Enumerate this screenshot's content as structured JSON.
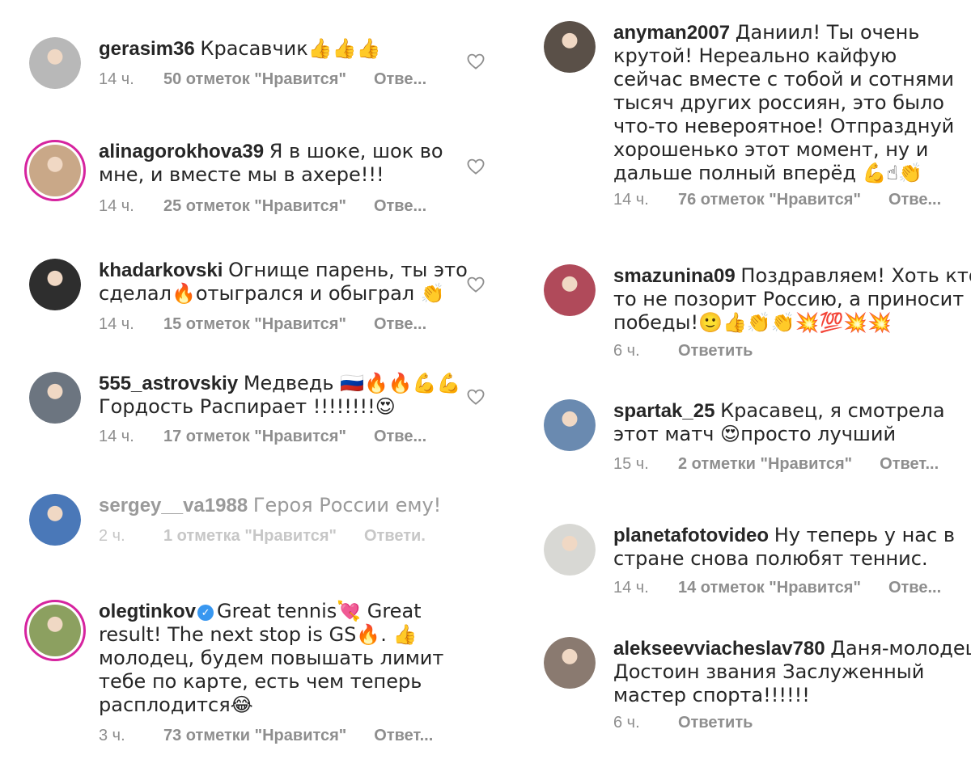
{
  "left_comments": [
    {
      "username": "gerasim36",
      "lines": [
        "Красавчик👍👍👍"
      ],
      "time": "14 ч.",
      "likes": "50 отметок \"Нравится\"",
      "reply": "Отве...",
      "avatar_color": "#b8b8b8"
    },
    {
      "username": "alinagorokhova39",
      "lines": [
        "Я в шоке, шок во",
        "мне, и вместе мы в ахере!!!"
      ],
      "time": "14 ч.",
      "likes": "25 отметок \"Нравится\"",
      "reply": "Отве...",
      "avatar_color": "#c9a888"
    },
    {
      "username": "khadarkovski",
      "lines": [
        "Огнище парень, ты это",
        "сделал🔥отыгрался и обыграл 👏"
      ],
      "time": "14 ч.",
      "likes": "15 отметок \"Нравится\"",
      "reply": "Отве...",
      "avatar_color": "#2e2e2e"
    },
    {
      "username": "555_astrovskiy",
      "lines": [
        "Медведь 🇷🇺🔥🔥💪💪",
        "Гордость Распирает !!!!!!!!😍"
      ],
      "time": "14 ч.",
      "likes": "17 отметок \"Нравится\"",
      "reply": "Отве...",
      "avatar_color": "#6c7580"
    },
    {
      "username": "sergey__va1988",
      "lines": [
        "Героя России ему!"
      ],
      "time": "2 ч.",
      "likes": "1 отметка \"Нравится\"",
      "reply": "Ответи.",
      "avatar_color": "#4a78b8"
    },
    {
      "username": "olegtinkov",
      "verified": true,
      "lines": [
        "Great tennis💘 Great",
        "result! The next stop is GS🔥. 👍",
        "молодец, будем повышать лимит",
        "тебе по карте, есть чем теперь",
        "расплодится😂"
      ],
      "time": "3 ч.",
      "likes": "73 отметки \"Нравится\"",
      "reply": "Ответ...",
      "avatar_color": "#8ca060"
    }
  ],
  "right_comments": [
    {
      "username": "anyman2007",
      "lines": [
        "Даниил! Ты очень",
        "крутой! Нереально кайфую",
        "сейчас вместе с тобой и сотнями",
        "тысяч других россиян, это было",
        "что-то невероятное! Отпразднуй",
        "хорошенько этот момент, ну и",
        "дальше полный вперёд 💪☝👏"
      ],
      "time": "14 ч.",
      "likes": "76 отметок \"Нравится\"",
      "reply": "Отве...",
      "avatar_color": "#5a5048"
    },
    {
      "username": "smazunina09",
      "lines": [
        "Поздравляем! Хоть кто",
        "то не позорит Россию,  а приносит",
        "победы!🙂👍👏👏💥💯💥💥"
      ],
      "time": "6 ч.",
      "likes": "",
      "reply": "Ответить",
      "avatar_color": "#b04a5a"
    },
    {
      "username": "spartak_25",
      "lines": [
        "Красавец, я смотрела",
        "этот матч 😍просто лучший"
      ],
      "time": "15 ч.",
      "likes": "2 отметки \"Нравится\"",
      "reply": "Ответ...",
      "avatar_color": "#6a8ab0"
    },
    {
      "username": "planetafotovideo",
      "lines": [
        "Ну теперь у нас в",
        "стране снова полюбят теннис."
      ],
      "time": "14 ч.",
      "likes": "14 отметок \"Нравится\"",
      "reply": "Отве...",
      "avatar_color": "#d8d8d4"
    },
    {
      "username": "alekseevviacheslav780",
      "lines": [
        "Даня-молодец!",
        "Достоин звания Заслуженный",
        "мастер спорта!!!!!!"
      ],
      "time": "6 ч.",
      "likes": "",
      "reply": "Ответить",
      "avatar_color": "#8a7a70"
    }
  ]
}
